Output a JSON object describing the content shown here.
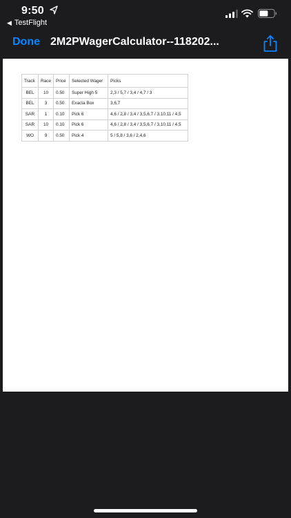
{
  "status_bar": {
    "time": "9:50",
    "back_app": "TestFlight"
  },
  "nav": {
    "done_label": "Done",
    "title": "2M2PWagerCalculator--118202..."
  },
  "table": {
    "headers": [
      "Track",
      "Race",
      "Price",
      "Selected Wager",
      "Picks"
    ],
    "rows": [
      [
        "BEL",
        "10",
        "0.50",
        "Super High 5",
        "2,3 / 5,7 / 3,4 / 4,7 / 3"
      ],
      [
        "BEL",
        "3",
        "0.50",
        "Exacta Box",
        "3,6,7"
      ],
      [
        "SAR",
        "1",
        "0.10",
        "Pick 6",
        "4,6 / 2,8 / 3,4 / 3,5,6,7 / 3,10,11 / 4,5"
      ],
      [
        "SAR",
        "10",
        "0.10",
        "Pick 6",
        "4,6 / 2,8 / 3,4 / 3,5,6,7 / 3,10,11 / 4,5"
      ],
      [
        "WO",
        "9",
        "0.50",
        "Pick 4",
        "5 / 5,8 / 3,6 / 2,4,6"
      ]
    ]
  },
  "colors": {
    "accent": "#0a84ff",
    "background": "#1c1c1e",
    "document": "#ffffff"
  },
  "icons": {
    "location": "location-arrow-icon",
    "signal": "cellular-signal-icon",
    "wifi": "wifi-icon",
    "battery": "battery-icon",
    "share": "share-icon"
  }
}
